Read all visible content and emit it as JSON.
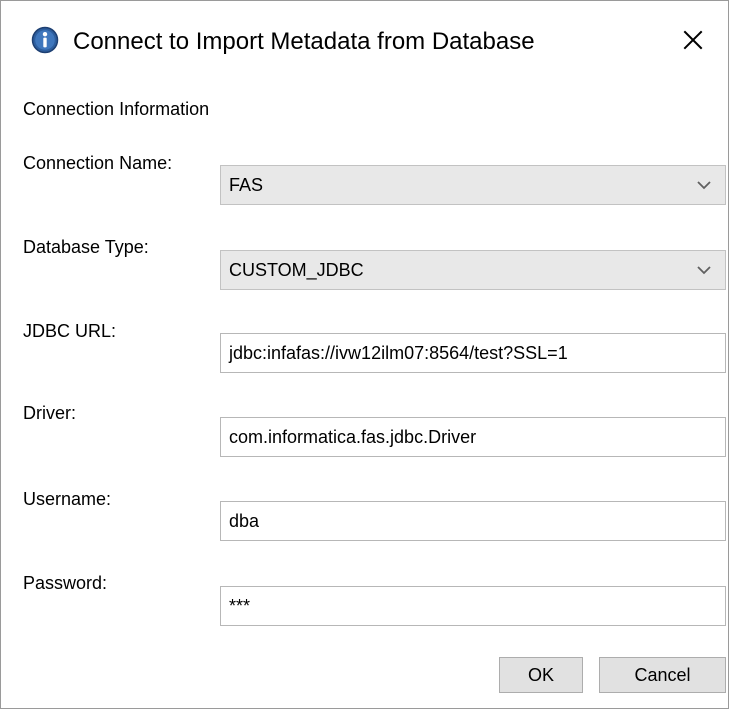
{
  "window": {
    "title": "Connect to Import Metadata from Database",
    "close_glyph": "✕"
  },
  "section": {
    "title": "Connection Information"
  },
  "fields": {
    "connection_name": {
      "label": "Connection Name:",
      "value": "FAS"
    },
    "database_type": {
      "label": "Database Type:",
      "value": "CUSTOM_JDBC"
    },
    "jdbc_url": {
      "label": "JDBC URL:",
      "value": "jdbc:infafas://ivw12ilm07:8564/test?SSL=1"
    },
    "driver": {
      "label": "Driver:",
      "value": "com.informatica.fas.jdbc.Driver"
    },
    "username": {
      "label": "Username:",
      "value": "dba"
    },
    "password": {
      "label": "Password:",
      "value": "***"
    }
  },
  "buttons": {
    "ok": "OK",
    "cancel": "Cancel"
  },
  "colors": {
    "accent": "#2d5e9e",
    "select_bg": "#e8e8e8",
    "button_bg": "#e1e1e1"
  },
  "icons": {
    "title": "info-icon",
    "close": "close-icon",
    "dropdown": "chevron-down-icon"
  }
}
